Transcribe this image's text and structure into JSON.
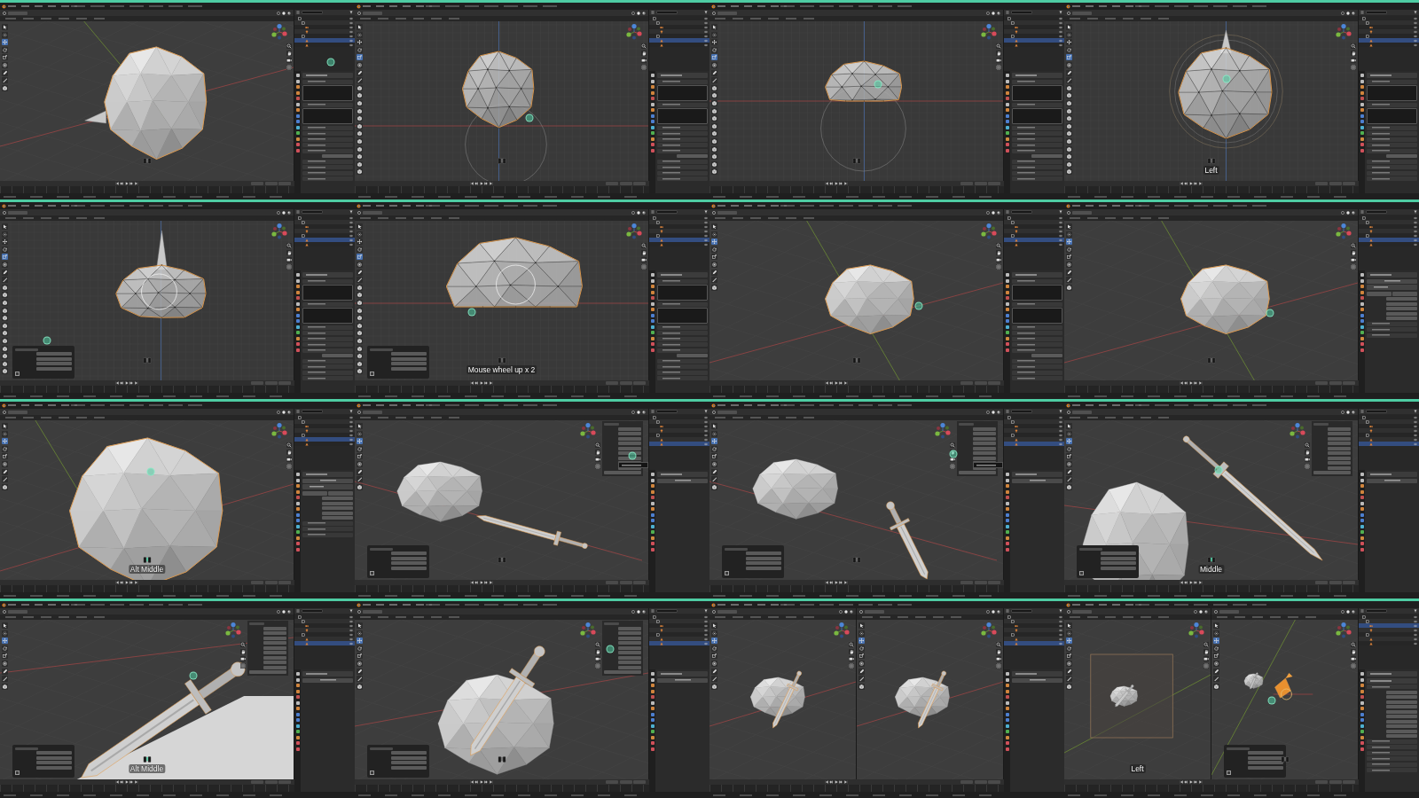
{
  "tiles": [
    {
      "edit_mode": false,
      "outliner": [
        {
          "kind": "collection",
          "selected": false,
          "children": [
            {
              "kind": "collection",
              "selected": false,
              "children": [
                {
                  "kind": "camera",
                  "selected": false
                },
                {
                  "kind": "light",
                  "selected": false
                }
              ]
            },
            {
              "kind": "collection",
              "selected": false,
              "children": [
                {
                  "kind": "mesh",
                  "selected": true
                },
                {
                  "kind": "mesh",
                  "selected": false
                }
              ]
            }
          ]
        }
      ],
      "properties": {
        "kind": "mesh-data"
      },
      "panes": [
        {
          "kind": "rock-persp",
          "mouse_icon": {
            "middle_pressed": false
          },
          "operator_panel": false,
          "sidebar": false,
          "tooltip": false
        }
      ]
    },
    {
      "edit_mode": true,
      "outliner": [
        {
          "kind": "collection",
          "selected": false,
          "children": [
            {
              "kind": "collection",
              "selected": false,
              "children": [
                {
                  "kind": "camera",
                  "selected": false
                },
                {
                  "kind": "light",
                  "selected": false
                }
              ]
            },
            {
              "kind": "collection",
              "selected": false,
              "children": [
                {
                  "kind": "mesh",
                  "selected": true
                },
                {
                  "kind": "mesh",
                  "selected": false
                }
              ]
            }
          ]
        }
      ],
      "properties": {
        "kind": "mesh-data"
      },
      "panes": [
        {
          "kind": "rock-front",
          "mouse_icon": {
            "middle_pressed": false
          },
          "operator_panel": false,
          "sidebar": false,
          "tooltip": false
        }
      ]
    },
    {
      "edit_mode": true,
      "outliner": [
        {
          "kind": "collection",
          "selected": false,
          "children": [
            {
              "kind": "collection",
              "selected": false,
              "children": [
                {
                  "kind": "camera",
                  "selected": false
                },
                {
                  "kind": "light",
                  "selected": false
                }
              ]
            },
            {
              "kind": "collection",
              "selected": false,
              "children": [
                {
                  "kind": "mesh",
                  "selected": true
                },
                {
                  "kind": "mesh",
                  "selected": false
                }
              ]
            }
          ]
        }
      ],
      "properties": {
        "kind": "mesh-data"
      },
      "panes": [
        {
          "kind": "dome-front",
          "mouse_icon": {
            "middle_pressed": false
          },
          "operator_panel": false,
          "sidebar": false,
          "tooltip": false
        }
      ]
    },
    {
      "edit_mode": true,
      "outliner": [
        {
          "kind": "collection",
          "selected": false,
          "children": [
            {
              "kind": "collection",
              "selected": false,
              "children": [
                {
                  "kind": "camera",
                  "selected": false
                },
                {
                  "kind": "light",
                  "selected": false
                }
              ]
            },
            {
              "kind": "collection",
              "selected": false,
              "children": [
                {
                  "kind": "mesh",
                  "selected": true
                },
                {
                  "kind": "mesh",
                  "selected": false
                }
              ]
            }
          ]
        }
      ],
      "properties": {
        "kind": "mesh-data"
      },
      "panes": [
        {
          "kind": "sphere-left",
          "caption": "Left",
          "mouse_icon": {
            "middle_pressed": false
          },
          "operator_panel": false,
          "sidebar": false,
          "tooltip": false
        }
      ]
    },
    {
      "edit_mode": true,
      "outliner": [
        {
          "kind": "collection",
          "selected": false,
          "children": [
            {
              "kind": "collection",
              "selected": false,
              "children": [
                {
                  "kind": "camera",
                  "selected": false
                },
                {
                  "kind": "light",
                  "selected": false
                }
              ]
            },
            {
              "kind": "collection",
              "selected": false,
              "children": [
                {
                  "kind": "mesh",
                  "selected": true
                },
                {
                  "kind": "mesh",
                  "selected": false
                }
              ]
            }
          ]
        }
      ],
      "properties": {
        "kind": "mesh-data"
      },
      "panes": [
        {
          "kind": "dome-left",
          "mouse_icon": {
            "middle_pressed": false
          },
          "operator_panel": true,
          "sidebar": false,
          "tooltip": false
        }
      ]
    },
    {
      "edit_mode": true,
      "outliner": [
        {
          "kind": "collection",
          "selected": false,
          "children": [
            {
              "kind": "collection",
              "selected": false,
              "children": [
                {
                  "kind": "camera",
                  "selected": false
                },
                {
                  "kind": "light",
                  "selected": false
                }
              ]
            },
            {
              "kind": "collection",
              "selected": false,
              "children": [
                {
                  "kind": "mesh",
                  "selected": true
                },
                {
                  "kind": "mesh",
                  "selected": false
                }
              ]
            }
          ]
        }
      ],
      "properties": {
        "kind": "mesh-data"
      },
      "panes": [
        {
          "kind": "wide-dome",
          "caption": "Mouse wheel up x 2",
          "mouse_icon": {
            "middle_pressed": false
          },
          "operator_panel": true,
          "sidebar": false,
          "tooltip": false
        }
      ]
    },
    {
      "edit_mode": false,
      "outliner": [
        {
          "kind": "collection",
          "selected": false,
          "children": [
            {
              "kind": "collection",
              "selected": false,
              "children": [
                {
                  "kind": "camera",
                  "selected": false
                },
                {
                  "kind": "light",
                  "selected": false
                }
              ]
            },
            {
              "kind": "collection",
              "selected": false,
              "children": [
                {
                  "kind": "mesh",
                  "selected": true
                },
                {
                  "kind": "mesh",
                  "selected": false
                }
              ]
            }
          ]
        }
      ],
      "properties": {
        "kind": "mesh-data"
      },
      "panes": [
        {
          "kind": "rock-small",
          "mouse_icon": {
            "middle_pressed": false
          },
          "operator_panel": false,
          "sidebar": false,
          "tooltip": false
        }
      ]
    },
    {
      "edit_mode": false,
      "outliner": [
        {
          "kind": "collection",
          "selected": false,
          "children": [
            {
              "kind": "collection",
              "selected": false,
              "children": [
                {
                  "kind": "camera",
                  "selected": false
                },
                {
                  "kind": "light",
                  "selected": false
                }
              ]
            },
            {
              "kind": "collection",
              "selected": false,
              "children": [
                {
                  "kind": "mesh",
                  "selected": true
                },
                {
                  "kind": "mesh",
                  "selected": false
                }
              ]
            }
          ]
        }
      ],
      "properties": {
        "kind": "modifiers"
      },
      "panes": [
        {
          "kind": "rock-small-2",
          "mouse_icon": {
            "middle_pressed": false
          },
          "operator_panel": false,
          "sidebar": false,
          "tooltip": false
        }
      ]
    },
    {
      "edit_mode": false,
      "outliner": [
        {
          "kind": "collection",
          "selected": false,
          "children": [
            {
              "kind": "collection",
              "selected": false,
              "children": [
                {
                  "kind": "camera",
                  "selected": false
                },
                {
                  "kind": "light",
                  "selected": false
                }
              ]
            },
            {
              "kind": "collection",
              "selected": false,
              "children": [
                {
                  "kind": "mesh",
                  "selected": true
                },
                {
                  "kind": "mesh",
                  "selected": false
                }
              ]
            }
          ]
        }
      ],
      "properties": {
        "kind": "modifiers"
      },
      "panes": [
        {
          "kind": "rock-closeup",
          "caption": "Alt Middle",
          "mouse_icon": {
            "middle_pressed": true
          },
          "operator_panel": false,
          "sidebar": false,
          "tooltip": false
        }
      ]
    },
    {
      "edit_mode": false,
      "outliner": [
        {
          "kind": "collection",
          "selected": false,
          "children": [
            {
              "kind": "collection",
              "selected": false,
              "children": [
                {
                  "kind": "camera",
                  "selected": false
                },
                {
                  "kind": "light",
                  "selected": false
                }
              ]
            },
            {
              "kind": "collection",
              "selected": false,
              "children": [
                {
                  "kind": "mesh",
                  "selected": false
                },
                {
                  "kind": "mesh",
                  "selected": true
                }
              ]
            }
          ]
        }
      ],
      "properties": {
        "kind": "modifiers-empty"
      },
      "panes": [
        {
          "kind": "rock-sword-a",
          "mouse_icon": {
            "middle_pressed": false
          },
          "operator_panel": true,
          "sidebar": true,
          "tooltip": true
        }
      ]
    },
    {
      "edit_mode": false,
      "outliner": [
        {
          "kind": "collection",
          "selected": false,
          "children": [
            {
              "kind": "collection",
              "selected": false,
              "children": [
                {
                  "kind": "camera",
                  "selected": false
                },
                {
                  "kind": "light",
                  "selected": false
                }
              ]
            },
            {
              "kind": "collection",
              "selected": false,
              "children": [
                {
                  "kind": "mesh",
                  "selected": false
                },
                {
                  "kind": "mesh",
                  "selected": true
                }
              ]
            }
          ]
        }
      ],
      "properties": {
        "kind": "modifiers-empty"
      },
      "panes": [
        {
          "kind": "rock-sword-b",
          "mouse_icon": {
            "middle_pressed": false
          },
          "operator_panel": true,
          "sidebar": true,
          "tooltip": true
        }
      ]
    },
    {
      "edit_mode": false,
      "outliner": [
        {
          "kind": "collection",
          "selected": false,
          "children": [
            {
              "kind": "collection",
              "selected": false,
              "children": [
                {
                  "kind": "camera",
                  "selected": false
                },
                {
                  "kind": "light",
                  "selected": false
                }
              ]
            },
            {
              "kind": "collection",
              "selected": false,
              "children": [
                {
                  "kind": "mesh",
                  "selected": false
                },
                {
                  "kind": "mesh",
                  "selected": true
                }
              ]
            }
          ]
        }
      ],
      "properties": {
        "kind": "modifiers-empty"
      },
      "panes": [
        {
          "kind": "rock-sword-c",
          "caption": "Middle",
          "mouse_icon": {
            "middle_pressed": true
          },
          "operator_panel": true,
          "sidebar": true,
          "tooltip": false
        }
      ]
    },
    {
      "edit_mode": false,
      "outliner": [
        {
          "kind": "collection",
          "selected": false,
          "children": [
            {
              "kind": "collection",
              "selected": false,
              "children": [
                {
                  "kind": "camera",
                  "selected": false
                },
                {
                  "kind": "light",
                  "selected": false
                }
              ]
            },
            {
              "kind": "collection",
              "selected": false,
              "children": [
                {
                  "kind": "mesh",
                  "selected": false
                },
                {
                  "kind": "mesh",
                  "selected": true
                }
              ]
            }
          ]
        }
      ],
      "properties": {
        "kind": "modifiers-empty"
      },
      "panes": [
        {
          "kind": "sword-closeup",
          "caption": "Alt Middle",
          "mouse_icon": {
            "middle_pressed": true
          },
          "operator_panel": true,
          "sidebar": true,
          "tooltip": false
        }
      ]
    },
    {
      "edit_mode": false,
      "outliner": [
        {
          "kind": "collection",
          "selected": false,
          "children": [
            {
              "kind": "collection",
              "selected": false,
              "children": [
                {
                  "kind": "camera",
                  "selected": false
                },
                {
                  "kind": "light",
                  "selected": false
                }
              ]
            },
            {
              "kind": "collection",
              "selected": false,
              "children": [
                {
                  "kind": "mesh",
                  "selected": false
                },
                {
                  "kind": "mesh",
                  "selected": true
                }
              ]
            }
          ]
        }
      ],
      "properties": {
        "kind": "modifiers-empty"
      },
      "panes": [
        {
          "kind": "rock-sword-d",
          "mouse_icon": {
            "middle_pressed": false
          },
          "operator_panel": true,
          "sidebar": true,
          "tooltip": false
        }
      ]
    },
    {
      "edit_mode": false,
      "outliner": [
        {
          "kind": "collection",
          "selected": false,
          "children": [
            {
              "kind": "collection",
              "selected": false,
              "children": [
                {
                  "kind": "camera",
                  "selected": false
                },
                {
                  "kind": "light",
                  "selected": false
                }
              ]
            },
            {
              "kind": "collection",
              "selected": false,
              "children": [
                {
                  "kind": "mesh",
                  "selected": false
                },
                {
                  "kind": "mesh",
                  "selected": true
                }
              ]
            }
          ]
        }
      ],
      "properties": {
        "kind": "modifiers-empty"
      },
      "panes": [
        {
          "kind": "split-a",
          "operator_panel": false,
          "sidebar": false,
          "tooltip": false
        },
        {
          "kind": "split-b",
          "operator_panel": false,
          "sidebar": false,
          "tooltip": false
        }
      ]
    },
    {
      "edit_mode": false,
      "outliner": [
        {
          "kind": "collection",
          "selected": false,
          "children": [
            {
              "kind": "collection",
              "selected": false,
              "children": [
                {
                  "kind": "camera",
                  "selected": true
                },
                {
                  "kind": "light",
                  "selected": false
                }
              ]
            },
            {
              "kind": "collection",
              "selected": false,
              "children": [
                {
                  "kind": "mesh",
                  "selected": false
                },
                {
                  "kind": "mesh",
                  "selected": false
                }
              ]
            }
          ]
        }
      ],
      "properties": {
        "kind": "object"
      },
      "panes": [
        {
          "kind": "camera-view",
          "caption": "Left",
          "operator_panel": false,
          "sidebar": false,
          "tooltip": false
        },
        {
          "kind": "camera-object",
          "mouse_icon": {
            "middle_pressed": false
          },
          "operator_panel": true,
          "sidebar": false,
          "tooltip": false
        }
      ]
    }
  ]
}
